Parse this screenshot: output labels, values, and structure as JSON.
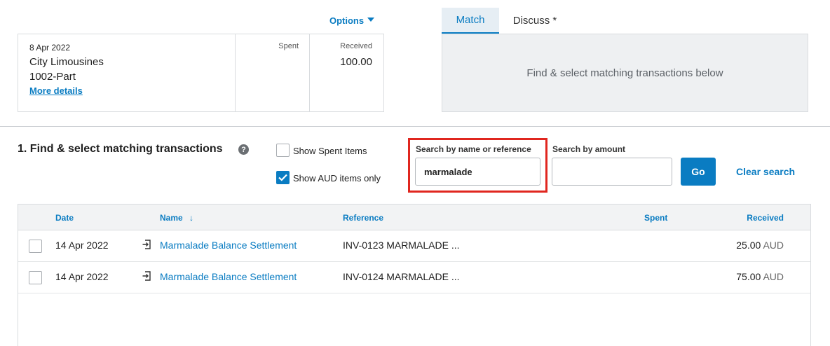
{
  "statement": {
    "options_label": "Options",
    "date": "8 Apr 2022",
    "payee": "City Limousines",
    "reference": "1002-Part",
    "more_details": "More details",
    "spent_header": "Spent",
    "received_header": "Received",
    "received_value": "100.00"
  },
  "tabs": [
    {
      "label": "Match",
      "active": true
    },
    {
      "label": "Discuss *",
      "active": false
    }
  ],
  "match_panel": {
    "message": "Find & select matching transactions below"
  },
  "find_section": {
    "title": "1. Find & select matching transactions",
    "help_icon": "?",
    "show_spent": {
      "label": "Show Spent Items",
      "checked": false
    },
    "show_aud": {
      "label": "Show AUD items only",
      "checked": true
    },
    "search_name": {
      "label": "Search by name or reference",
      "value": "marmalade"
    },
    "search_amount": {
      "label": "Search by amount",
      "value": ""
    },
    "go_label": "Go",
    "clear_label": "Clear search"
  },
  "table": {
    "headers": {
      "date": "Date",
      "name": "Name",
      "reference": "Reference",
      "spent": "Spent",
      "received": "Received"
    },
    "sort_indicator": "↓",
    "rows": [
      {
        "date": "14 Apr 2022",
        "name": "Marmalade Balance Settlement",
        "reference": "INV-0123 MARMALADE ...",
        "received": "25.00",
        "currency": "AUD"
      },
      {
        "date": "14 Apr 2022",
        "name": "Marmalade Balance Settlement",
        "reference": "INV-0124 MARMALADE ...",
        "received": "75.00",
        "currency": "AUD"
      }
    ]
  },
  "colors": {
    "accent": "#0a7cc2",
    "highlight": "#e0261f"
  },
  "icons": {
    "caret": "chevron-down-icon",
    "help": "help-icon",
    "checkbox": "checkbox-icon",
    "document": "document-import-icon"
  }
}
